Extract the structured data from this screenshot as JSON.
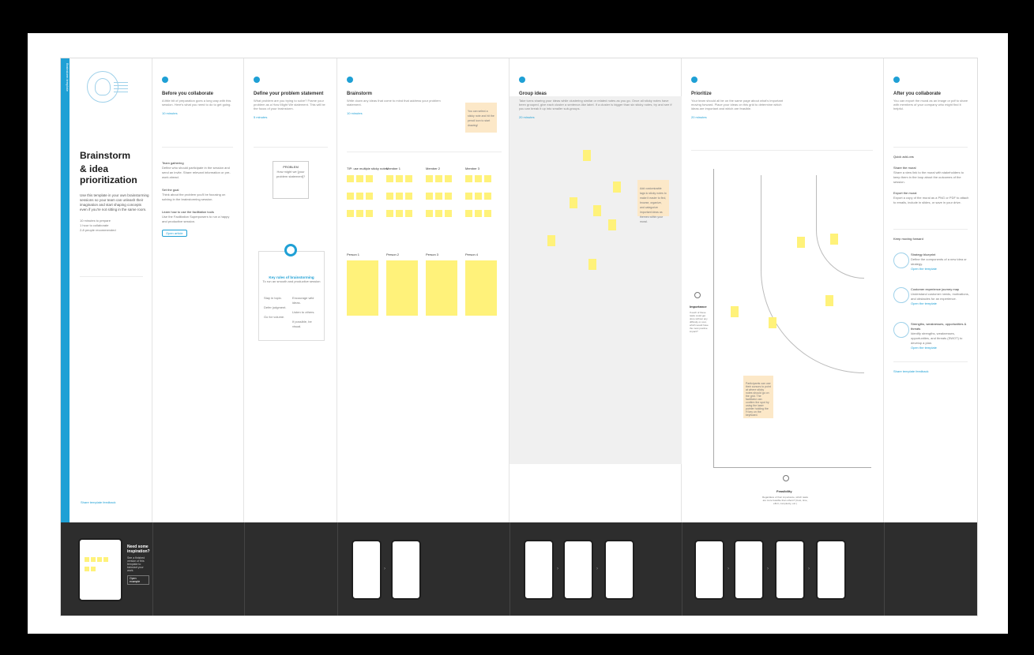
{
  "template": {
    "title_line1": "Brainstorm",
    "title_line2": "& idea prioritization",
    "description": "Use this template in your own brainstorming sessions so your team can unleash their imagination and start shaping concepts even if you're not sitting in the same room.",
    "meta": [
      "10 minutes to prepare",
      "1 hour to collaborate",
      "2-8 people recommended"
    ],
    "footer_link": "Share template feedback",
    "sidebar_strip_label": "Brainstorm template"
  },
  "columns": [
    {
      "id": "collaborate",
      "title": "Before you collaborate",
      "body": "A little bit of preparation goes a long way with this session. Here's what you need to do to get going.",
      "time": "10 minutes"
    },
    {
      "id": "problem",
      "title": "Define your problem statement",
      "body": "What problem are you trying to solve? Frame your problem as a How Might We statement. This will be the focus of your brainstorm.",
      "time": "5 minutes"
    },
    {
      "id": "brainstorm",
      "title": "Brainstorm",
      "body": "Write down any ideas that come to mind that address your problem statement.",
      "time": "10 minutes"
    },
    {
      "id": "group",
      "title": "Group ideas",
      "body": "Take turns sharing your ideas while clustering similar or related notes as you go. Once all sticky notes have been grouped, give each cluster a sentence-like label. If a cluster is bigger than six sticky notes, try and see if you can break it up into smaller sub-groups.",
      "time": "20 minutes"
    },
    {
      "id": "prioritize",
      "title": "Prioritize",
      "body": "Your team should all be on the same page about what's important moving forward. Place your ideas on this grid to determine which ideas are important and which are feasible.",
      "time": "20 minutes"
    },
    {
      "id": "after",
      "title": "After you collaborate",
      "body": "You can export the mural as an image or pdf to share with members of your company who might find it helpful.",
      "time": ""
    }
  ],
  "collaborate_steps": [
    {
      "title": "Team gathering",
      "body": "Define who should participate in the session and send an invite. Share relevant information or pre-work ahead."
    },
    {
      "title": "Set the goal",
      "body": "Think about the problem you'll be focusing on solving in the brainstorming session."
    },
    {
      "title": "Learn how to use the facilitation tools",
      "body": "Use the Facilitation Superpowers to run a happy and productive session."
    }
  ],
  "collaborate_button": "Open article",
  "problem_card": {
    "heading": "PROBLEM",
    "text": "How might we [your problem statement]?"
  },
  "key_rules": {
    "title": "Key rules of brainstorming",
    "subtitle": "To run an smooth and productive session",
    "rules": [
      "Stay in topic.",
      "Encourage wild ideas.",
      "Defer judgment.",
      "Listen to others.",
      "Go for volume.",
      "If possible, be visual."
    ]
  },
  "brainstorm_people": [
    "Person 1",
    "Person 2",
    "Person 3",
    "Person 4"
  ],
  "brainstorm_headers": [
    "TIP: use multiple sticky notes",
    "Member 1",
    "Member 2",
    "Member 3"
  ],
  "brainstorm_tip": "You can select a sticky note and hit the pencil icon to start drawing!",
  "group_tip": "Add customizable tags to sticky notes to make it easier to find, browse, organize, and categorize important ideas as themes within your mural.",
  "prioritize_axis_x": "Feasibility",
  "prioritize_axis_x_note": "Regardless of their importance, which tasks are more feasible than others? (Cost, time, effort, complexity, etc.)",
  "prioritize_axis_y": "Importance",
  "prioritize_axis_y_note": "If each of these tasks could get done without any difficulty or cost, which would have the most positive impact?",
  "prioritize_tip": "Participants can use their cursors to point at where sticky notes should go on the grid. The facilitator can confirm the spot by using the laser pointer holding the H key on the keyboard.",
  "after": {
    "quick_add": "Quick add-ons",
    "addons": [
      {
        "title": "Share the mural",
        "body": "Share a view link to the mural with stakeholders to keep them in the loop about the outcomes of the session."
      },
      {
        "title": "Export the mural",
        "body": "Export a copy of the mural as a PNG or PDF to attach to emails, include in slides, or save in your drive."
      }
    ],
    "keep_moving": "Keep moving forward",
    "links": [
      {
        "title": "Strategy blueprint",
        "body": "Define the components of a new idea or strategy.",
        "cta": "Open the template"
      },
      {
        "title": "Customer experience journey map",
        "body": "Understand customer needs, motivations, and obstacles for an experience.",
        "cta": "Open the template"
      },
      {
        "title": "Strengths, weaknesses, opportunities & threats",
        "body": "Identify strengths, weaknesses, opportunities, and threats (SWOT) to develop a plan.",
        "cta": "Open the template"
      }
    ],
    "feedback": "Share template feedback"
  },
  "bottom": {
    "need_inspiration": "Need some inspiration?",
    "inspiration_body": "See a finished version of this template to kickstart your work.",
    "open_example": "Open example"
  },
  "colors": {
    "accent": "#1fa0d5",
    "sticky": "#fff27a",
    "dark_bar": "#2d2d2d"
  }
}
